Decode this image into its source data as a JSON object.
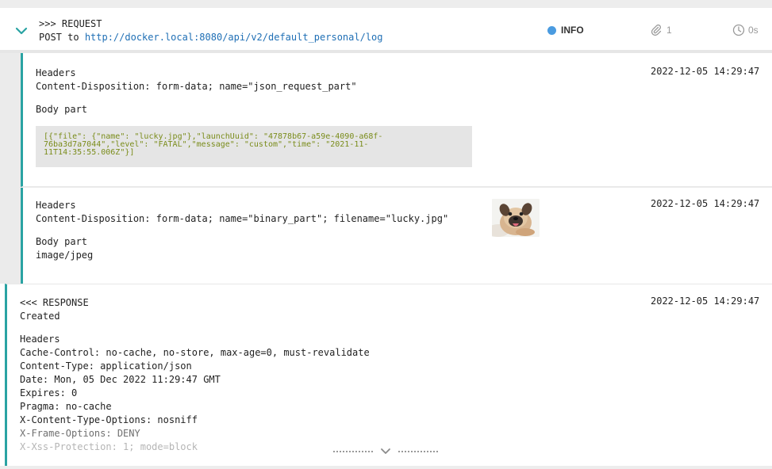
{
  "request": {
    "marker": ">>> REQUEST",
    "method": "POST to",
    "url": "http://docker.local:8080/api/v2/default_personal/log",
    "level": "INFO",
    "attachments_count": "1",
    "duration": "0s",
    "colors": {
      "level_dot": "#4a9be0",
      "accent_border": "#2aa3a3",
      "url": "#1f6fb5",
      "json_text": "#7a8c1a"
    }
  },
  "parts": [
    {
      "headers_label": "Headers",
      "content_disposition": "Content-Disposition: form-data; name=\"json_request_part\"",
      "body_label": "Body part",
      "body_lines": [
        "[{\"file\": {\"name\": \"lucky.jpg\"},\"launchUuid\": \"47878b67-a59e-4090-a68f-",
        "76ba3d7a7044\",\"level\": \"FATAL\",\"message\": \"custom\",\"time\": \"2021-11-",
        "11T14:35:55.006Z\"}]"
      ],
      "timestamp": "2022-12-05 14:29:47"
    },
    {
      "headers_label": "Headers",
      "content_disposition": "Content-Disposition: form-data; name=\"binary_part\"; filename=\"lucky.jpg\"",
      "body_label": "Body part",
      "body_value": "image/jpeg",
      "timestamp": "2022-12-05 14:29:47",
      "thumbnail_icon": "pug-photo-thumbnail"
    }
  ],
  "response": {
    "marker": "<<< RESPONSE",
    "status": "Created",
    "timestamp": "2022-12-05 14:29:47",
    "headers_label": "Headers",
    "headers": [
      "Cache-Control: no-cache, no-store, max-age=0, must-revalidate",
      "Content-Type: application/json",
      "Date: Mon, 05 Dec 2022 11:29:47 GMT",
      "Expires: 0",
      "Pragma: no-cache",
      "X-Content-Type-Options: nosniff",
      "X-Frame-Options: DENY",
      "X-Xss-Protection: 1; mode=block"
    ]
  },
  "icons": {
    "collapse": "chevron-down-icon",
    "attachment": "paperclip-icon",
    "duration": "clock-icon",
    "expand": "chevron-down-icon"
  }
}
